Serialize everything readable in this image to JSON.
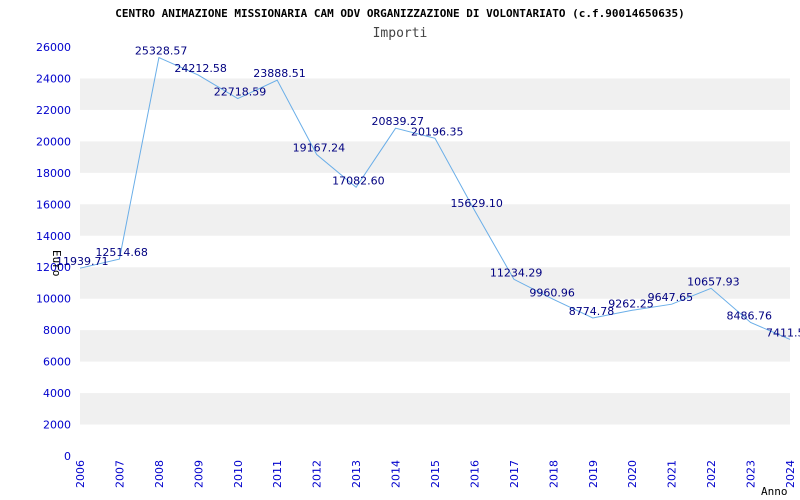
{
  "chart_data": {
    "type": "line",
    "title": "CENTRO ANIMAZIONE MISSIONARIA CAM ODV ORGANIZZAZIONE DI VOLONTARIATO (c.f.90014650635)",
    "subtitle": "Importi",
    "xlabel": "Anno",
    "ylabel": "Euro",
    "x": [
      "2006",
      "2007",
      "2008",
      "2009",
      "2010",
      "2011",
      "2012",
      "2013",
      "2014",
      "2015",
      "2016",
      "2017",
      "2018",
      "2019",
      "2020",
      "2021",
      "2022",
      "2023",
      "2024"
    ],
    "series": [
      {
        "values": [
          11939.71,
          12514.68,
          25328.57,
          24212.58,
          22718.59,
          23888.51,
          19167.24,
          17082.6,
          20839.27,
          20196.35,
          15629.1,
          11234.29,
          9960.96,
          8774.78,
          9262.25,
          9647.65,
          10657.93,
          8486.76,
          7411.5
        ],
        "labels": [
          "11939.71",
          "12514.68",
          "25328.57",
          "24212.58",
          "22718.59",
          "23888.51",
          "19167.24",
          "17082.60",
          "20839.27",
          "20196.35",
          "15629.10",
          "11234.29",
          "9960.96",
          "8774.78",
          "9262.25",
          "9647.65",
          "10657.93",
          "8486.76",
          "7411.5"
        ]
      }
    ],
    "ylim": [
      0,
      26000
    ],
    "yticks": [
      "0",
      "2000",
      "4000",
      "6000",
      "8000",
      "10000",
      "12000",
      "14000",
      "16000",
      "18000",
      "20000",
      "22000",
      "24000",
      "26000"
    ],
    "grid": "horizontal bands",
    "colors": {
      "line": "#6aaee8",
      "band": "#f0f0f0",
      "axis_text": "#0000cc",
      "label_text": "#000080",
      "title_text": "#000000",
      "subtitle_text": "#444444"
    }
  }
}
